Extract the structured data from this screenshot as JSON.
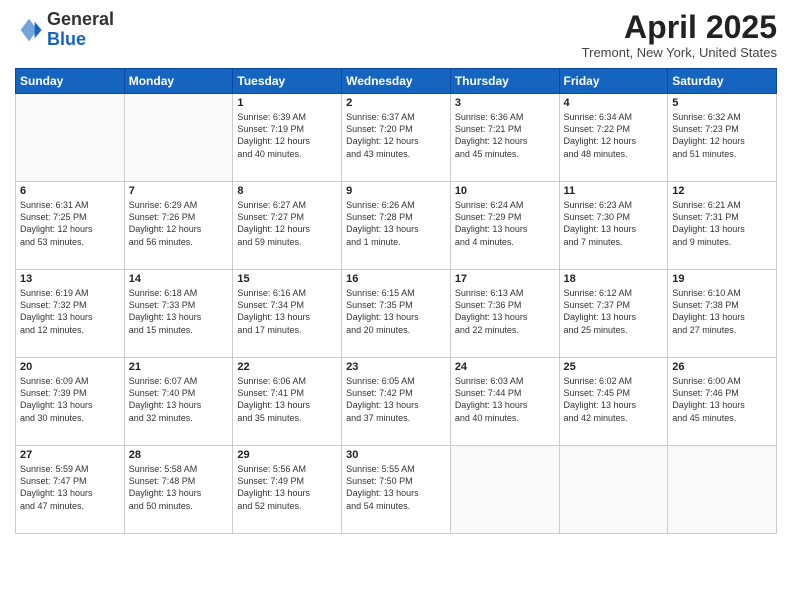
{
  "header": {
    "logo_general": "General",
    "logo_blue": "Blue",
    "title": "April 2025",
    "location": "Tremont, New York, United States"
  },
  "weekdays": [
    "Sunday",
    "Monday",
    "Tuesday",
    "Wednesday",
    "Thursday",
    "Friday",
    "Saturday"
  ],
  "weeks": [
    [
      {
        "day": "",
        "info": ""
      },
      {
        "day": "",
        "info": ""
      },
      {
        "day": "1",
        "info": "Sunrise: 6:39 AM\nSunset: 7:19 PM\nDaylight: 12 hours\nand 40 minutes."
      },
      {
        "day": "2",
        "info": "Sunrise: 6:37 AM\nSunset: 7:20 PM\nDaylight: 12 hours\nand 43 minutes."
      },
      {
        "day": "3",
        "info": "Sunrise: 6:36 AM\nSunset: 7:21 PM\nDaylight: 12 hours\nand 45 minutes."
      },
      {
        "day": "4",
        "info": "Sunrise: 6:34 AM\nSunset: 7:22 PM\nDaylight: 12 hours\nand 48 minutes."
      },
      {
        "day": "5",
        "info": "Sunrise: 6:32 AM\nSunset: 7:23 PM\nDaylight: 12 hours\nand 51 minutes."
      }
    ],
    [
      {
        "day": "6",
        "info": "Sunrise: 6:31 AM\nSunset: 7:25 PM\nDaylight: 12 hours\nand 53 minutes."
      },
      {
        "day": "7",
        "info": "Sunrise: 6:29 AM\nSunset: 7:26 PM\nDaylight: 12 hours\nand 56 minutes."
      },
      {
        "day": "8",
        "info": "Sunrise: 6:27 AM\nSunset: 7:27 PM\nDaylight: 12 hours\nand 59 minutes."
      },
      {
        "day": "9",
        "info": "Sunrise: 6:26 AM\nSunset: 7:28 PM\nDaylight: 13 hours\nand 1 minute."
      },
      {
        "day": "10",
        "info": "Sunrise: 6:24 AM\nSunset: 7:29 PM\nDaylight: 13 hours\nand 4 minutes."
      },
      {
        "day": "11",
        "info": "Sunrise: 6:23 AM\nSunset: 7:30 PM\nDaylight: 13 hours\nand 7 minutes."
      },
      {
        "day": "12",
        "info": "Sunrise: 6:21 AM\nSunset: 7:31 PM\nDaylight: 13 hours\nand 9 minutes."
      }
    ],
    [
      {
        "day": "13",
        "info": "Sunrise: 6:19 AM\nSunset: 7:32 PM\nDaylight: 13 hours\nand 12 minutes."
      },
      {
        "day": "14",
        "info": "Sunrise: 6:18 AM\nSunset: 7:33 PM\nDaylight: 13 hours\nand 15 minutes."
      },
      {
        "day": "15",
        "info": "Sunrise: 6:16 AM\nSunset: 7:34 PM\nDaylight: 13 hours\nand 17 minutes."
      },
      {
        "day": "16",
        "info": "Sunrise: 6:15 AM\nSunset: 7:35 PM\nDaylight: 13 hours\nand 20 minutes."
      },
      {
        "day": "17",
        "info": "Sunrise: 6:13 AM\nSunset: 7:36 PM\nDaylight: 13 hours\nand 22 minutes."
      },
      {
        "day": "18",
        "info": "Sunrise: 6:12 AM\nSunset: 7:37 PM\nDaylight: 13 hours\nand 25 minutes."
      },
      {
        "day": "19",
        "info": "Sunrise: 6:10 AM\nSunset: 7:38 PM\nDaylight: 13 hours\nand 27 minutes."
      }
    ],
    [
      {
        "day": "20",
        "info": "Sunrise: 6:09 AM\nSunset: 7:39 PM\nDaylight: 13 hours\nand 30 minutes."
      },
      {
        "day": "21",
        "info": "Sunrise: 6:07 AM\nSunset: 7:40 PM\nDaylight: 13 hours\nand 32 minutes."
      },
      {
        "day": "22",
        "info": "Sunrise: 6:06 AM\nSunset: 7:41 PM\nDaylight: 13 hours\nand 35 minutes."
      },
      {
        "day": "23",
        "info": "Sunrise: 6:05 AM\nSunset: 7:42 PM\nDaylight: 13 hours\nand 37 minutes."
      },
      {
        "day": "24",
        "info": "Sunrise: 6:03 AM\nSunset: 7:44 PM\nDaylight: 13 hours\nand 40 minutes."
      },
      {
        "day": "25",
        "info": "Sunrise: 6:02 AM\nSunset: 7:45 PM\nDaylight: 13 hours\nand 42 minutes."
      },
      {
        "day": "26",
        "info": "Sunrise: 6:00 AM\nSunset: 7:46 PM\nDaylight: 13 hours\nand 45 minutes."
      }
    ],
    [
      {
        "day": "27",
        "info": "Sunrise: 5:59 AM\nSunset: 7:47 PM\nDaylight: 13 hours\nand 47 minutes."
      },
      {
        "day": "28",
        "info": "Sunrise: 5:58 AM\nSunset: 7:48 PM\nDaylight: 13 hours\nand 50 minutes."
      },
      {
        "day": "29",
        "info": "Sunrise: 5:56 AM\nSunset: 7:49 PM\nDaylight: 13 hours\nand 52 minutes."
      },
      {
        "day": "30",
        "info": "Sunrise: 5:55 AM\nSunset: 7:50 PM\nDaylight: 13 hours\nand 54 minutes."
      },
      {
        "day": "",
        "info": ""
      },
      {
        "day": "",
        "info": ""
      },
      {
        "day": "",
        "info": ""
      }
    ]
  ]
}
